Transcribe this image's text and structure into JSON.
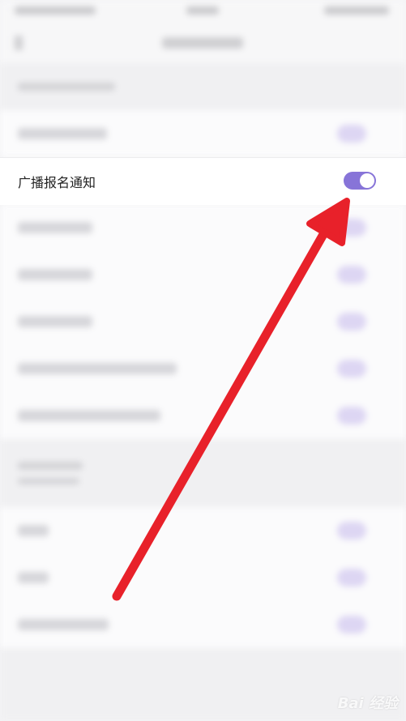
{
  "settings": {
    "highlighted_row": {
      "label": "广播报名通知",
      "toggle_on": true
    }
  },
  "colors": {
    "accent": "#8774d8",
    "arrow": "#e8212a",
    "background": "#f4f4f6"
  },
  "icons": {
    "toggle": "toggle-switch-icon",
    "arrow": "annotation-arrow"
  },
  "watermark": {
    "text": "Bai 经验"
  }
}
